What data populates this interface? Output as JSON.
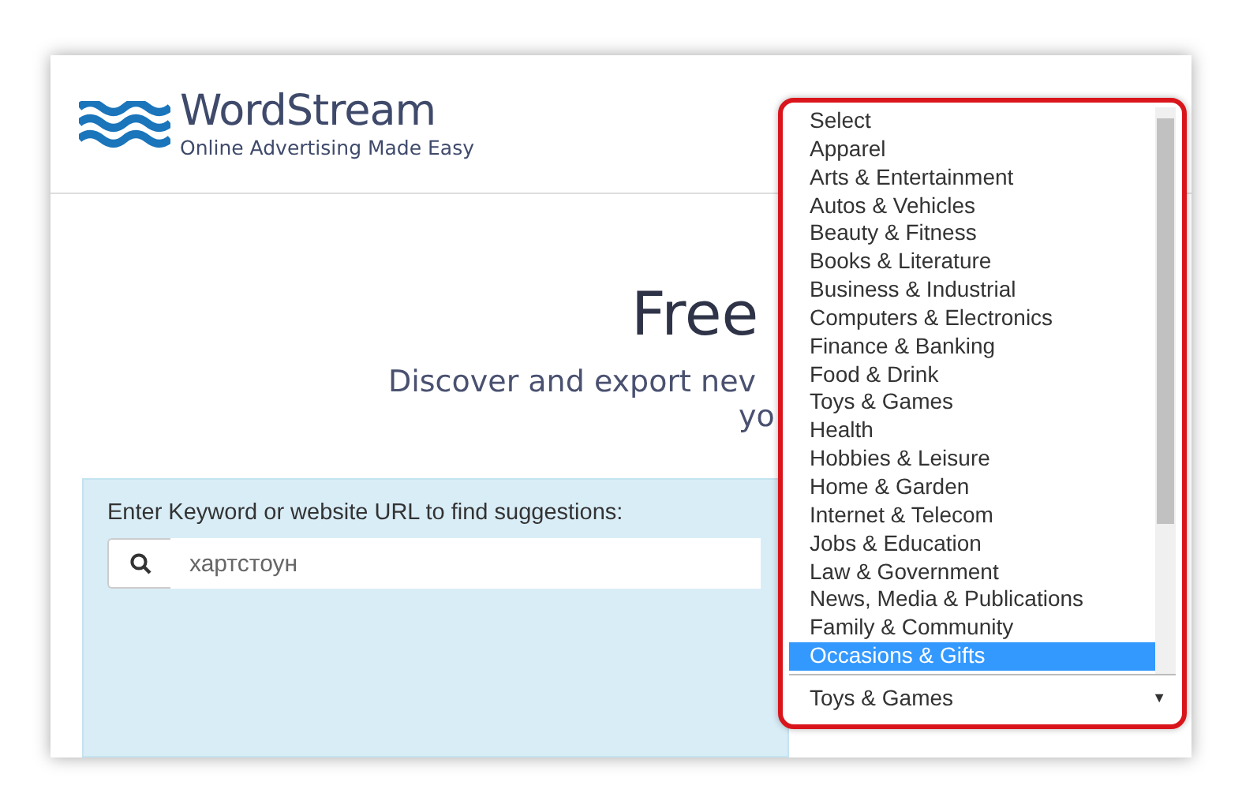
{
  "header": {
    "logo": {
      "name": "WordStream",
      "tagline": "Online Advertising Made Easy"
    }
  },
  "hero": {
    "title": "Free",
    "subtitle_lines": [
      "Discover and export nev",
      "yo"
    ]
  },
  "search": {
    "label": "Enter Keyword or website URL to find suggestions:",
    "value": "хартстоун"
  },
  "category_select": {
    "value": "Toys & Games",
    "arrow": "▼",
    "options": [
      {
        "label": "Select",
        "highlighted": false
      },
      {
        "label": "Apparel",
        "highlighted": false
      },
      {
        "label": "Arts & Entertainment",
        "highlighted": false
      },
      {
        "label": "Autos & Vehicles",
        "highlighted": false
      },
      {
        "label": "Beauty & Fitness",
        "highlighted": false
      },
      {
        "label": "Books & Literature",
        "highlighted": false
      },
      {
        "label": "Business & Industrial",
        "highlighted": false
      },
      {
        "label": "Computers & Electronics",
        "highlighted": false
      },
      {
        "label": "Finance & Banking",
        "highlighted": false
      },
      {
        "label": "Food & Drink",
        "highlighted": false
      },
      {
        "label": "Toys & Games",
        "highlighted": false
      },
      {
        "label": "Health",
        "highlighted": false
      },
      {
        "label": "Hobbies & Leisure",
        "highlighted": false
      },
      {
        "label": "Home & Garden",
        "highlighted": false
      },
      {
        "label": "Internet & Telecom",
        "highlighted": false
      },
      {
        "label": "Jobs & Education",
        "highlighted": false
      },
      {
        "label": "Law & Government",
        "highlighted": false
      },
      {
        "label": "News, Media & Publications",
        "highlighted": false
      },
      {
        "label": "Family & Community",
        "highlighted": false
      },
      {
        "label": "Occasions & Gifts",
        "highlighted": true
      }
    ]
  }
}
